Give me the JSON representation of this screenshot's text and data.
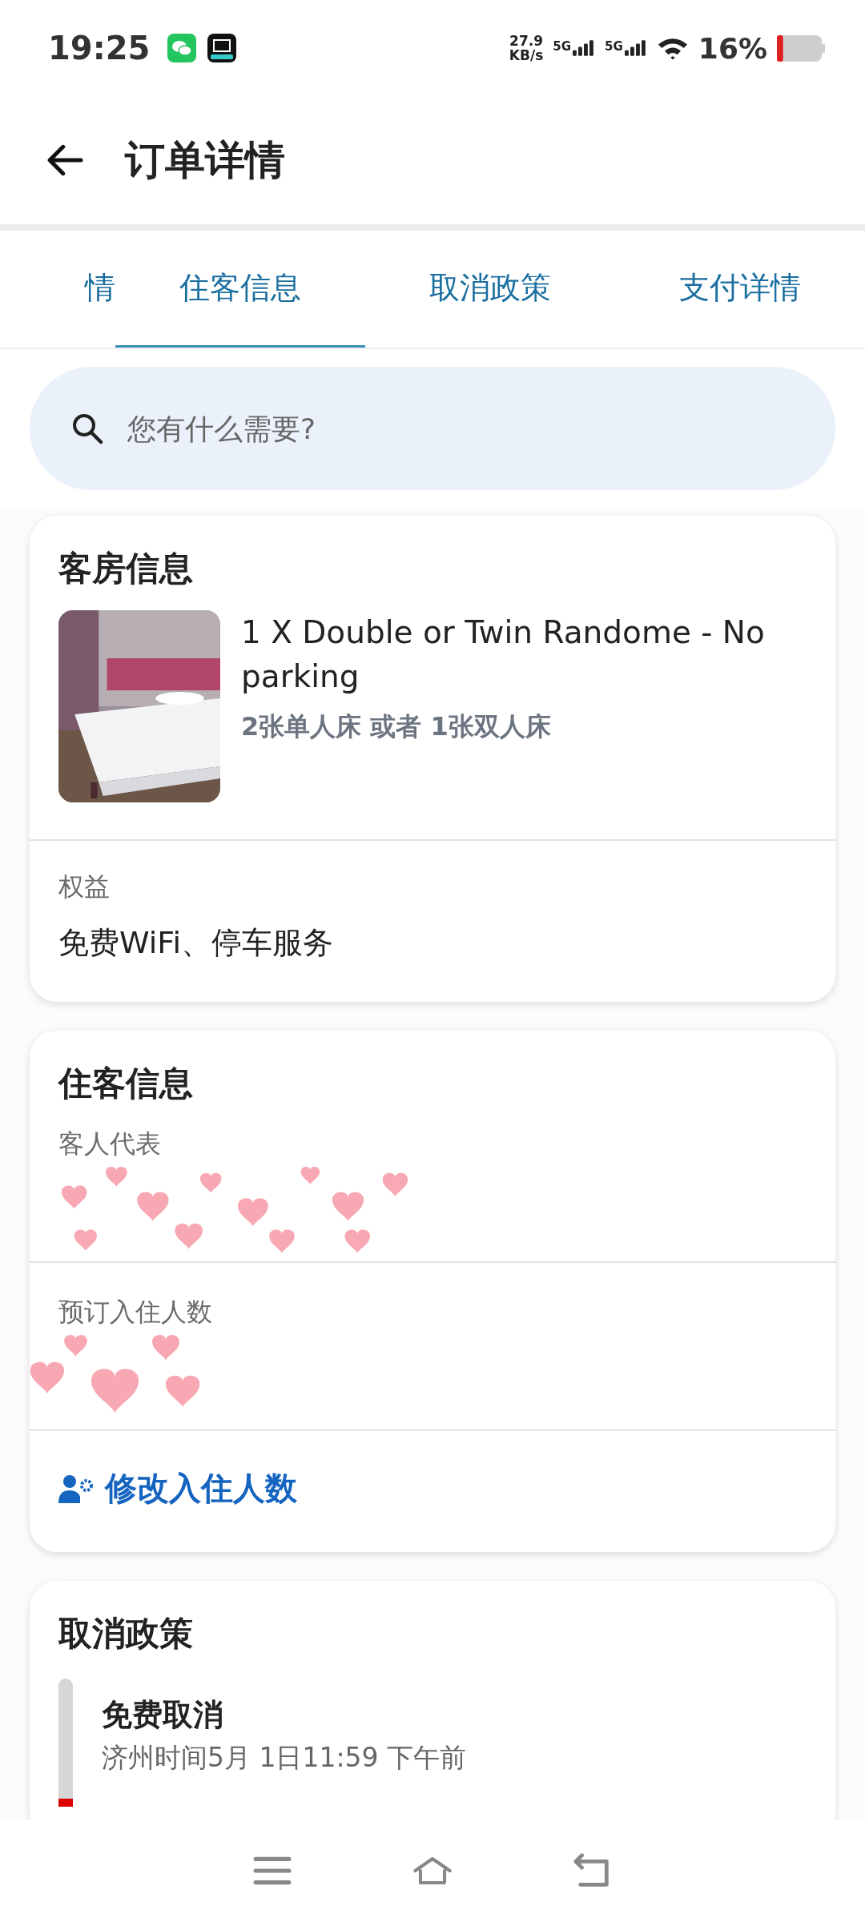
{
  "status_bar": {
    "time": "19:25",
    "net_speed": [
      "27.9",
      "KB/s"
    ],
    "sims": [
      "5G",
      "5G"
    ],
    "battery": "16%"
  },
  "header": {
    "title": "订单详情"
  },
  "tabs": [
    {
      "label": "情",
      "selected": false
    },
    {
      "label": "住客信息",
      "selected": true
    },
    {
      "label": "取消政策",
      "selected": false
    },
    {
      "label": "支付详情",
      "selected": false
    }
  ],
  "search": {
    "placeholder": "您有什么需要?"
  },
  "room_card": {
    "title": "客房信息",
    "room_name": "1 X Double or Twin Randome - No parking",
    "beds": "2张单人床 或者 1张双人床",
    "benefits_label": "权益",
    "benefits": "免费WiFi、停车服务"
  },
  "guest_card": {
    "title": "住客信息",
    "fields": [
      {
        "label": "客人代表"
      },
      {
        "label": "预订入住人数"
      }
    ],
    "action": "修改入住人数"
  },
  "cancel_card": {
    "title": "取消政策",
    "policies": [
      {
        "title": "免费取消",
        "detail": "济州时间5月 1日11:59 下午前"
      }
    ]
  }
}
